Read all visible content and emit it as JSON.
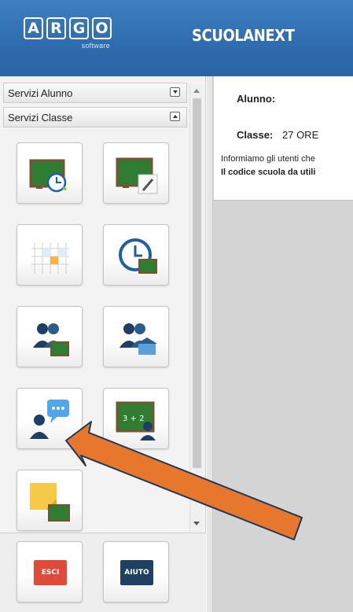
{
  "header": {
    "logo_letters": [
      "A",
      "R",
      "G",
      "O"
    ],
    "logo_subtitle": "software",
    "brand": "SCUOLANEXT",
    "background_color": "#2f6db0"
  },
  "sidebar": {
    "sections": [
      {
        "label": "Servizi Alunno",
        "state": "collapsed"
      },
      {
        "label": "Servizi Classe",
        "state": "expanded"
      }
    ],
    "tiles": [
      {
        "icon": "blackboard-clock-icon"
      },
      {
        "icon": "blackboard-pencil-icon"
      },
      {
        "icon": "calendar-grid-icon"
      },
      {
        "icon": "clock-blackboard-icon"
      },
      {
        "icon": "students-blackboard-icon"
      },
      {
        "icon": "students-school-icon"
      },
      {
        "icon": "teacher-speech-bubble-icon"
      },
      {
        "icon": "math-blackboard-teacher-icon"
      },
      {
        "icon": "sticky-note-blackboard-icon"
      }
    ],
    "bottom_buttons": [
      {
        "label": "ESCI",
        "color": "#e04a3a"
      },
      {
        "label": "AIUTO",
        "color": "#1f3f63"
      }
    ]
  },
  "main": {
    "alunno_label": "Alunno:",
    "classe_label": "Classe:",
    "classe_value": "27 ORE",
    "notice_line1": "Informiamo gli utenti che",
    "notice_line2": "Il codice scuola da utili"
  },
  "annotation": {
    "arrow_color": "#e8772e",
    "points_to": "teacher-speech-bubble-icon"
  }
}
